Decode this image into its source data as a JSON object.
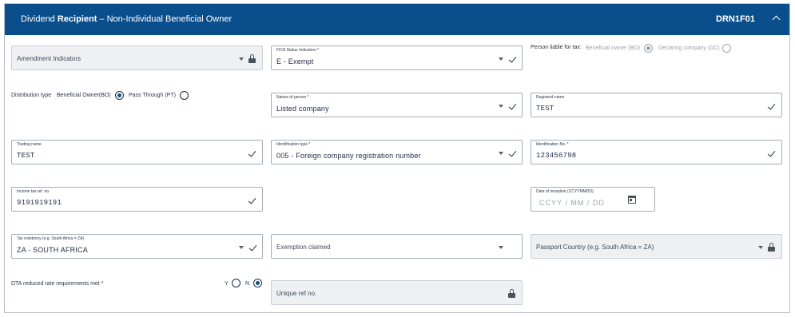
{
  "header": {
    "title_prefix": "Dividend ",
    "title_bold": "Recipient",
    "title_suffix": " – Non-Individual Beneficial Owner",
    "code": "DRN1F01"
  },
  "fields": {
    "amendment": {
      "placeholder": "Amendment Indicators"
    },
    "fica": {
      "label": "FICA Status Indicators *",
      "value": "E - Exempt"
    },
    "person_liable": {
      "label": "Person liable for tax:",
      "option_bo": "Beneficial owner (BO)",
      "option_dc": "Declaring company (DC)"
    },
    "distribution_type": {
      "label": "Distribution type",
      "option_bo": "Beneficial Owner(BO)",
      "option_pt": "Pass Through (PT)"
    },
    "nature": {
      "label": "Nature of person *",
      "value": "Listed company"
    },
    "registered_name": {
      "label": "Registerd name",
      "value": "TEST"
    },
    "trading_name": {
      "label": "Trading name",
      "value": "TEST"
    },
    "id_type": {
      "label": "Identification type *",
      "value": "005 - Foreign company registration number"
    },
    "id_no": {
      "label": "Identification No. *",
      "value": "123456798"
    },
    "income_tax": {
      "label": "Income tax ref. no.",
      "value": "9191919191"
    },
    "date_inception": {
      "label": "Date of inception (CCYYMMDD)",
      "value": "CCYY / MM / DD"
    },
    "tax_residency": {
      "label": "Tax residency (e.g. South Africa = ZA)",
      "value": "ZA - SOUTH AFRICA"
    },
    "exemption": {
      "placeholder": "Exemption claimed"
    },
    "passport_country": {
      "placeholder": "Passport Country (e.g. South Africa = ZA)"
    },
    "dta": {
      "label": "DTA reduced rate requirements met *",
      "yes": "Y",
      "no": "N"
    },
    "unique_ref": {
      "placeholder": "Unique ref no."
    }
  },
  "colors": {
    "header_bg": "#0a4f8c",
    "accent": "#0a4f8c",
    "disabled_bg": "#eef0f2"
  },
  "icons": [
    "chevron-up-icon",
    "caret-down-icon",
    "check-icon",
    "lock-icon",
    "calendar-icon",
    "radio-icon"
  ]
}
